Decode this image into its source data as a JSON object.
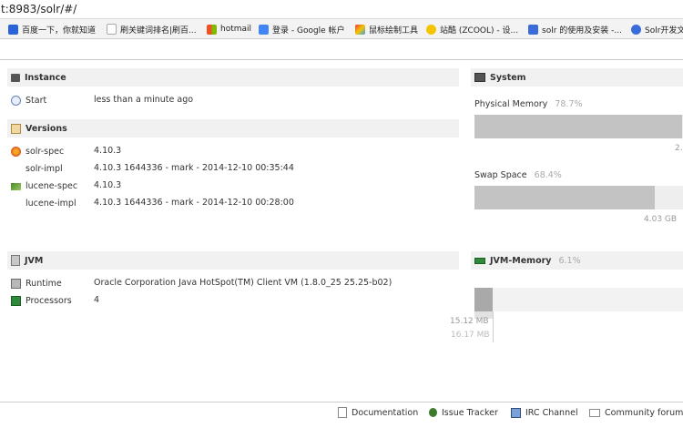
{
  "browser": {
    "url": "t:8983/solr/#/",
    "bookmarks": [
      {
        "label": "百度一下，你就知道",
        "color": "#2a64d8"
      },
      {
        "label": "刷关键词排名|刷百...",
        "color": "#ffffff"
      },
      {
        "label": "hotmail",
        "color": "#f25022"
      },
      {
        "label": "登录 - Google 帐户",
        "color": "#4285f4"
      },
      {
        "label": "鼠标绘制工具",
        "color": "#e63c3c"
      },
      {
        "label": "站酷 (ZCOOL) - 设...",
        "color": "#f5c400"
      },
      {
        "label": "solr 的使用及安装 -...",
        "color": "#3a6bd8"
      },
      {
        "label": "Solr开发文",
        "color": "#3a6bd8"
      }
    ]
  },
  "instance": {
    "title": "Instance",
    "start_label": "Start",
    "start_value": "less than a minute ago"
  },
  "versions": {
    "title": "Versions",
    "rows": [
      {
        "label": "solr-spec",
        "value": "4.10.3",
        "icon": "solr-icon"
      },
      {
        "label": "solr-impl",
        "value": "4.10.3 1644336 - mark - 2014-12-10 00:35:44",
        "icon": ""
      },
      {
        "label": "lucene-spec",
        "value": "4.10.3",
        "icon": "lucene-icon"
      },
      {
        "label": "lucene-impl",
        "value": "4.10.3 1644336 - mark - 2014-12-10 00:28:00",
        "icon": ""
      }
    ]
  },
  "jvm": {
    "title": "JVM",
    "runtime_label": "Runtime",
    "runtime_value": "Oracle Corporation Java HotSpot(TM) Client VM (1.8.0_25 25.25-b02)",
    "processors_label": "Processors",
    "processors_value": "4"
  },
  "system": {
    "title": "System",
    "physical_label": "Physical Memory",
    "physical_pct": "78.7%",
    "physical_fraction": 0.787,
    "physical_value": "2.",
    "swap_label": "Swap Space",
    "swap_pct": "68.4%",
    "swap_fraction": 0.684,
    "swap_value": "4.03 GB"
  },
  "jvm_memory": {
    "title": "JVM-Memory",
    "pct": "6.1%",
    "used": "15.12 MB",
    "total": "16.17 MB"
  },
  "footer": {
    "documentation": "Documentation",
    "issue_tracker": "Issue Tracker",
    "irc_channel": "IRC Channel",
    "community_forum": "Community forum"
  }
}
